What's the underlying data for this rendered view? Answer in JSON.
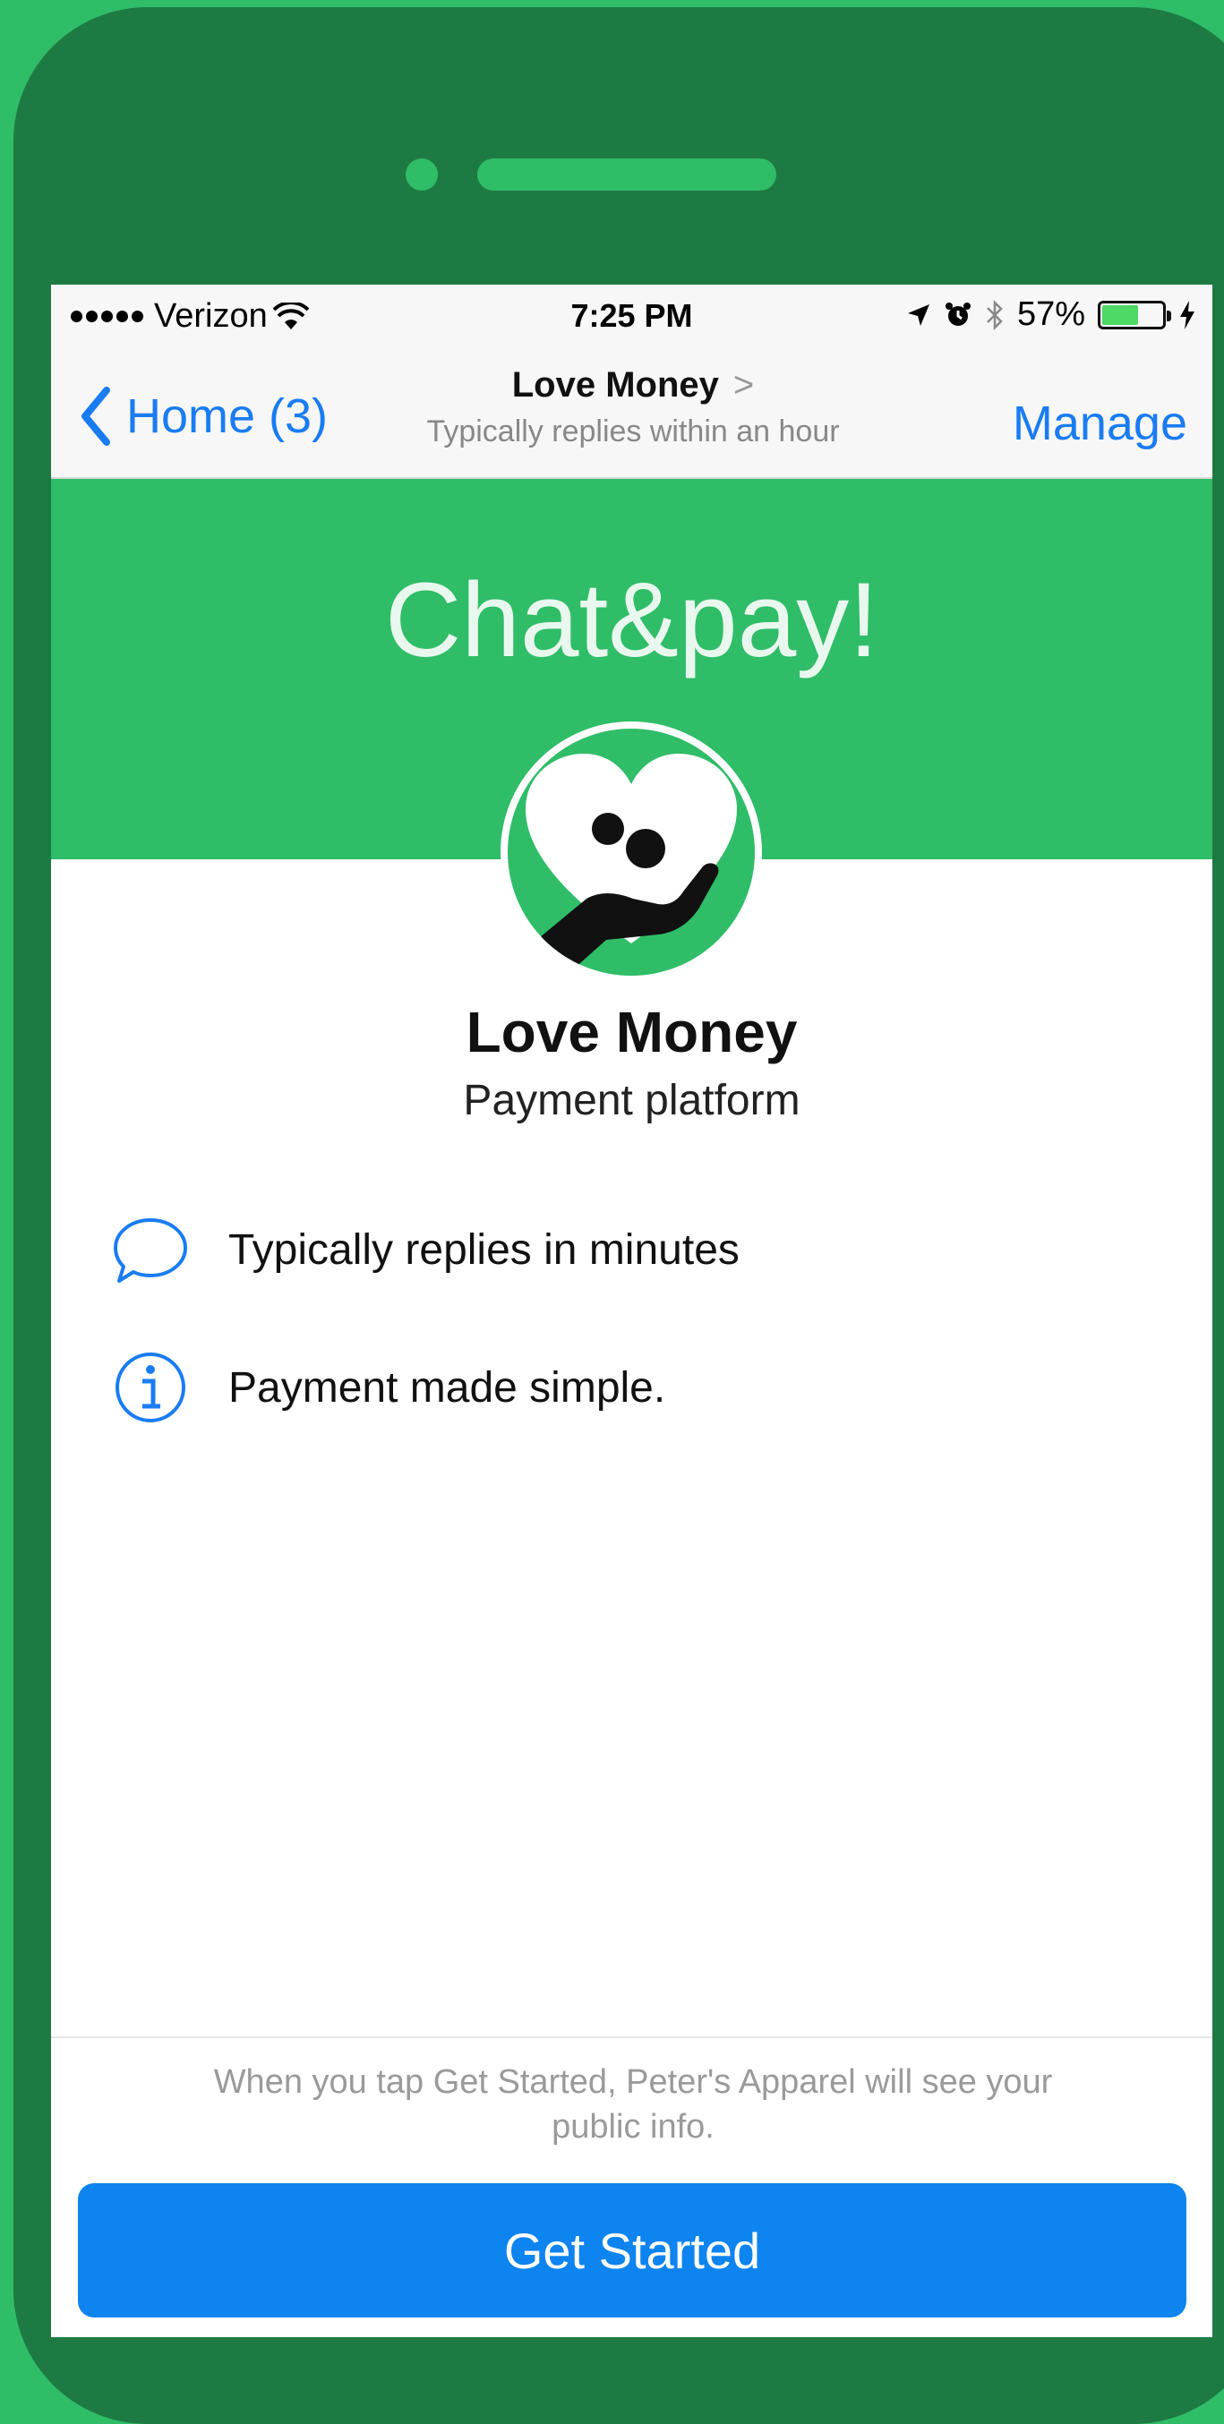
{
  "status_bar": {
    "carrier": "Verizon",
    "time": "7:25 PM",
    "battery": "57%",
    "battery_level": 0.57
  },
  "nav": {
    "back_label": "Home (3)",
    "title": "Love Money",
    "title_chevron": ">",
    "subtitle": "Typically replies within an hour",
    "manage_label": "Manage"
  },
  "banner": {
    "title": "Chat&pay!"
  },
  "page": {
    "name": "Love Money",
    "category": "Payment platform"
  },
  "info_rows": [
    {
      "icon": "speech-bubble-icon",
      "text": "Typically replies in minutes"
    },
    {
      "icon": "info-icon",
      "text": "Payment made simple."
    }
  ],
  "footer": {
    "disclaimer": "When you tap Get Started, Peter's Apparel will see your public info.",
    "button_label": "Get Started"
  },
  "colors": {
    "brand_green": "#2fbd68",
    "phone_dark_green": "#1e7a43",
    "ios_blue": "#1a7cf2",
    "button_blue": "#0d84ef"
  }
}
